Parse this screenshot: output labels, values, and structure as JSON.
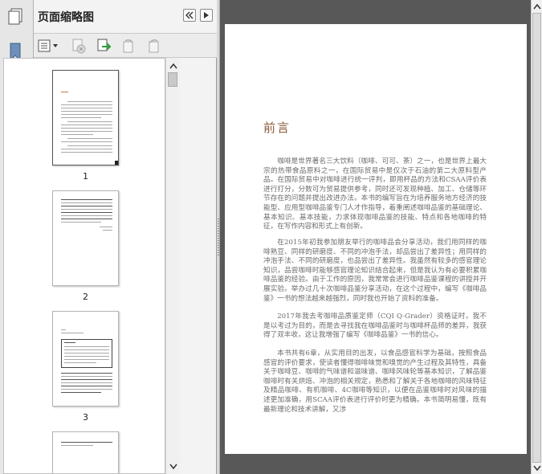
{
  "panel": {
    "title": "页面缩略图"
  },
  "sidebar_icons": [
    "bookmark-icon",
    "attachment-icon",
    "signature-icon",
    "layers-icon"
  ],
  "thumbnails": [
    {
      "page_number": "1"
    },
    {
      "page_number": "2"
    },
    {
      "page_number": "3"
    }
  ],
  "document": {
    "title": "前言",
    "paragraphs": [
      "咖啡是世界著名三大饮料（咖啡、可可、茶）之一，也是世界上最大宗的热带食品原料之一，在国际贸易中是仅次于石油的第二大原料型产品。在国际贸易中对咖啡进行统一评判，即用杯品的方法和CSAA评价表进行打分，分数可为贸易提供参考，同时还可发现种植、加工、仓储等环节存在的问题并提出改进办法。本书的编写旨在为培养服务地方经济的技能型、应用型咖啡品鉴专门人才作指导，着重阐述咖啡品鉴的基础理论、基本知识、基本技能，力求体现咖啡品鉴的技能、特点和各地咖啡的特征，在写作内容和形式上有创新。",
      "在2015年初我参加朋友举行的咖啡品会分享活动，我们用同样的咖啡熟豆、同样的研磨度、不同的冲泡手法，却品尝出了差异性；用同样的冲泡手法、不同的研磨度，也品尝出了差异性。我虽然有较多的感官理论知识，品尝咖啡时能够感官理论知识结合起来，但是我认为有必要积累咖啡品鉴的经验。由于工作的原因，我常常会进行咖啡品鉴课程的讲授并开展实验。举办过几十次咖啡品鉴分享活动，在这个过程中，编写《咖啡品鉴》一书的想法越来越强烈，同时我也开始了资料的准备。",
      "2017年我去考咖啡品质鉴定师（CQI Q-Grader）资格证时，我不是以考过为目的，而是去寻找我在咖啡品鉴时与咖啡杯品师的差异，我获得了双丰收，这让我增强了编写《咖啡品鉴》一书的信心。",
      "本书共有6章，从实用目的出发，以食品感官科学为基础，按照食品感官的评价要求，使读者懂得咖啡味觉和嗅觉的产生过程及其特性，具备关于咖啡豆、咖啡的气味谱和滋味谱、咖啡风味轮等基本知识，了解品鉴咖啡时有关烘焙、冲泡的相关规定，熟悉和了解关于各地咖啡的风味特征及精品咖啡、有机咖啡、4C咖啡等知识，以便在品鉴咖啡时对风味的描述更加准确，用SCAA评价表进行评价时更为精确。本书简明易懂，既有最新理论和技术讲解，又涉"
    ]
  }
}
